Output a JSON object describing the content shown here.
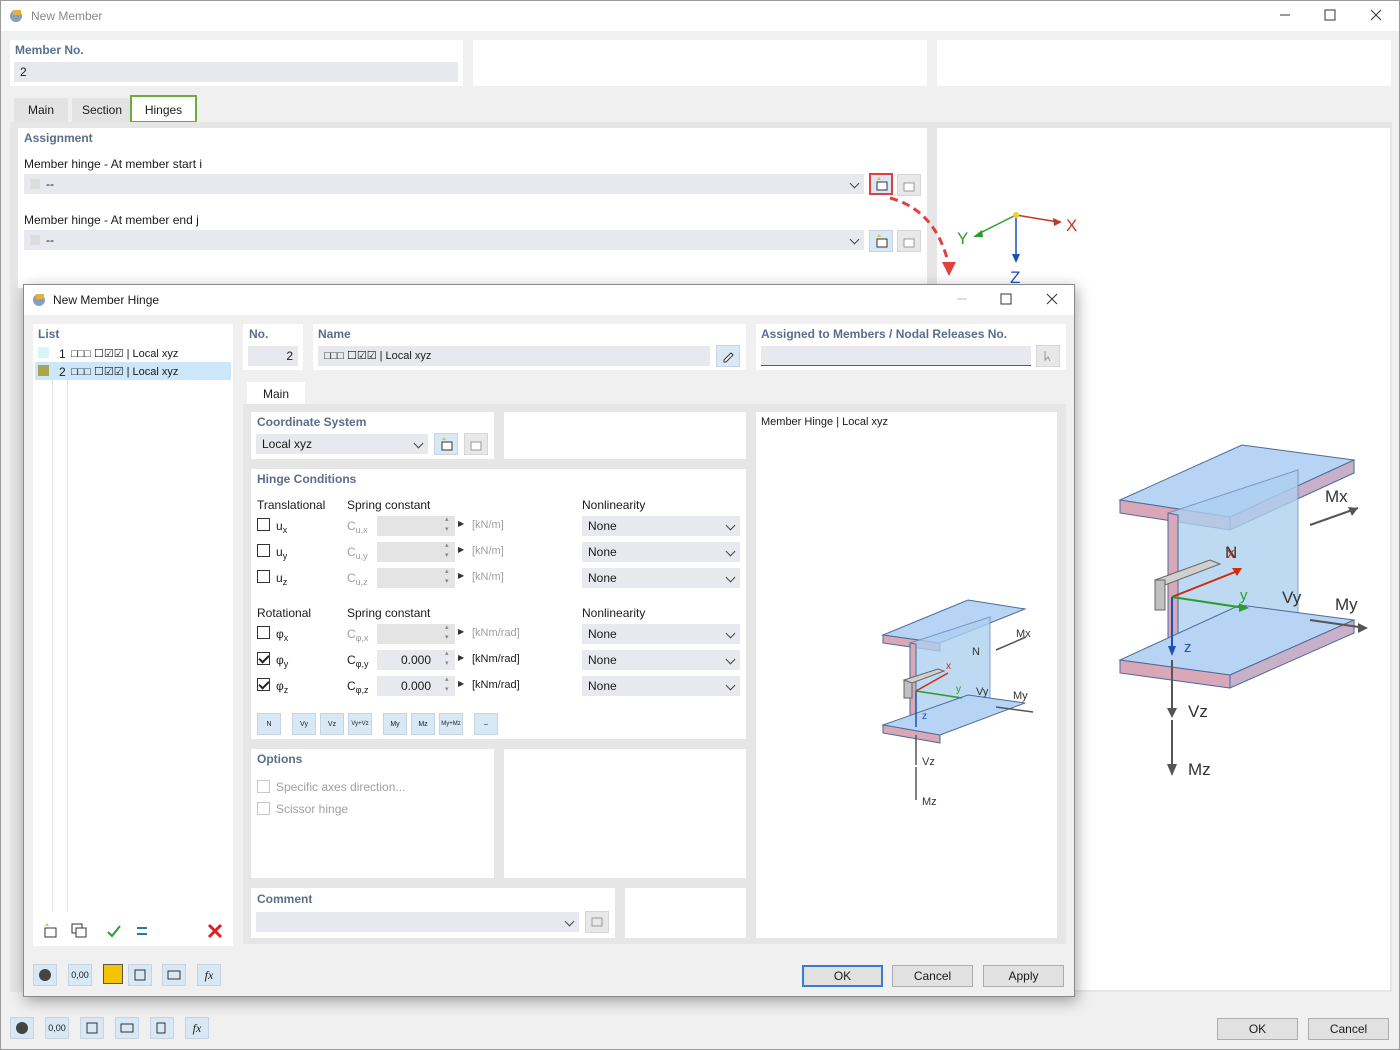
{
  "outer": {
    "title": "New Member",
    "member_no_label": "Member No.",
    "member_no": "2",
    "tabs": [
      "Main",
      "Section",
      "Hinges"
    ],
    "assignment": "Assignment",
    "hinge_start_label": "Member hinge - At member start i",
    "hinge_start_value": "--",
    "hinge_end_label": "Member hinge - At member end j",
    "hinge_end_value": "--",
    "ok": "OK",
    "cancel": "Cancel"
  },
  "axes": {
    "x": "X",
    "y": "Y",
    "z": "Z"
  },
  "dialog": {
    "title": "New Member Hinge",
    "list_label": "List",
    "list_items": [
      {
        "no": "1",
        "text": "□□□ ☐☑☑ | Local xyz",
        "color": "#d8f4f8"
      },
      {
        "no": "2",
        "text": "□□□ ☐☑☑ | Local xyz",
        "color": "#aaa44c"
      }
    ],
    "no_label": "No.",
    "no_value": "2",
    "name_label": "Name",
    "name_value": "□□□ ☐☑☑ | Local xyz",
    "assigned_label": "Assigned to Members / Nodal Releases No.",
    "tab_main": "Main",
    "cs_label": "Coordinate System",
    "cs_value": "Local xyz",
    "hc_label": "Hinge Conditions",
    "translational": "Translational",
    "rotational": "Rotational",
    "spring_constant": "Spring constant",
    "nonlinearity": "Nonlinearity",
    "rows_t": [
      {
        "sym": "u",
        "sub": "x",
        "c": "C",
        "csub": "u,x",
        "val": "",
        "unit": "[kN/m]",
        "nl": "None",
        "checked": false
      },
      {
        "sym": "u",
        "sub": "y",
        "c": "C",
        "csub": "u,y",
        "val": "",
        "unit": "[kN/m]",
        "nl": "None",
        "checked": false
      },
      {
        "sym": "u",
        "sub": "z",
        "c": "C",
        "csub": "u,z",
        "val": "",
        "unit": "[kN/m]",
        "nl": "None",
        "checked": false
      }
    ],
    "rows_r": [
      {
        "sym": "φ",
        "sub": "x",
        "c": "C",
        "csub": "φ,x",
        "val": "",
        "unit": "[kNm/rad]",
        "nl": "None",
        "checked": false
      },
      {
        "sym": "φ",
        "sub": "y",
        "c": "C",
        "csub": "φ,y",
        "val": "0.000",
        "unit": "[kNm/rad]",
        "nl": "None",
        "checked": true
      },
      {
        "sym": "φ",
        "sub": "z",
        "c": "C",
        "csub": "φ,z",
        "val": "0.000",
        "unit": "[kNm/rad]",
        "nl": "None",
        "checked": true
      }
    ],
    "options_label": "Options",
    "opt1": "Specific axes direction...",
    "opt2": "Scissor hinge",
    "comment_label": "Comment",
    "preview_label": "Member Hinge | Local xyz",
    "ok": "OK",
    "cancel": "Cancel",
    "apply": "Apply",
    "bottom_val": "0,00"
  },
  "labels3d": {
    "N": "N",
    "x": "x",
    "y": "y",
    "z": "z",
    "Mx": "Mx",
    "My": "My",
    "Vy": "Vy",
    "Vz": "Vz",
    "Mz": "Mz"
  }
}
